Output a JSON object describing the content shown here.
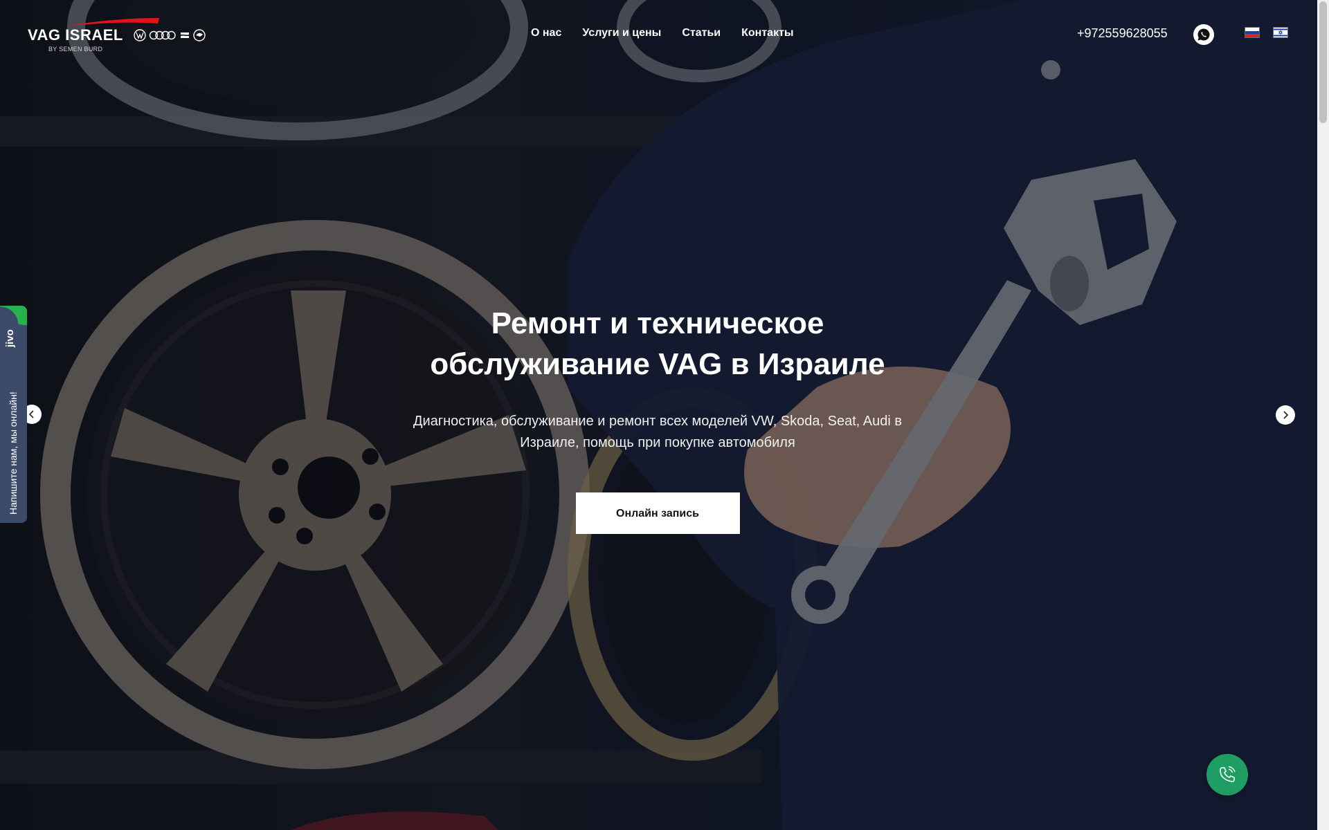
{
  "header": {
    "logo": {
      "main": "VAG ISRAEL",
      "sub": "BY SEMEN BURD",
      "brand_icons": [
        "volkswagen-icon",
        "audi-rings-icon",
        "seat-icon",
        "skoda-icon"
      ]
    },
    "nav": [
      {
        "label": "О нас"
      },
      {
        "label": "Услуги и цены"
      },
      {
        "label": "Статьи"
      },
      {
        "label": "Контакты"
      }
    ],
    "phone": "+972559628055",
    "whatsapp_icon": "whatsapp-icon",
    "languages": [
      {
        "code": "ru",
        "icon": "flag-russia-icon"
      },
      {
        "code": "he",
        "icon": "flag-israel-icon"
      }
    ]
  },
  "hero": {
    "title_line1": "Ремонт и техническое",
    "title_line2": "обслуживание VAG в Израиле",
    "subtitle": "Диагностика, обслуживание и ремонт всех моделей VW, Skoda, Seat, Audi в Израиле, помощь при покупке автомобиля",
    "cta": "Онлайн запись",
    "prev_icon": "chevron-left-icon",
    "next_icon": "chevron-right-icon"
  },
  "jivo": {
    "brand": "jivo",
    "text": "Напишите нам, мы онлайн!"
  },
  "call_button": {
    "icon": "phone-call-icon"
  },
  "colors": {
    "accent_red": "#e3131e",
    "call_green": "#1e9e63",
    "jivo_green": "#27b34a",
    "jivo_bg": "#3c4b6a",
    "cta_bg": "#ffffff"
  }
}
